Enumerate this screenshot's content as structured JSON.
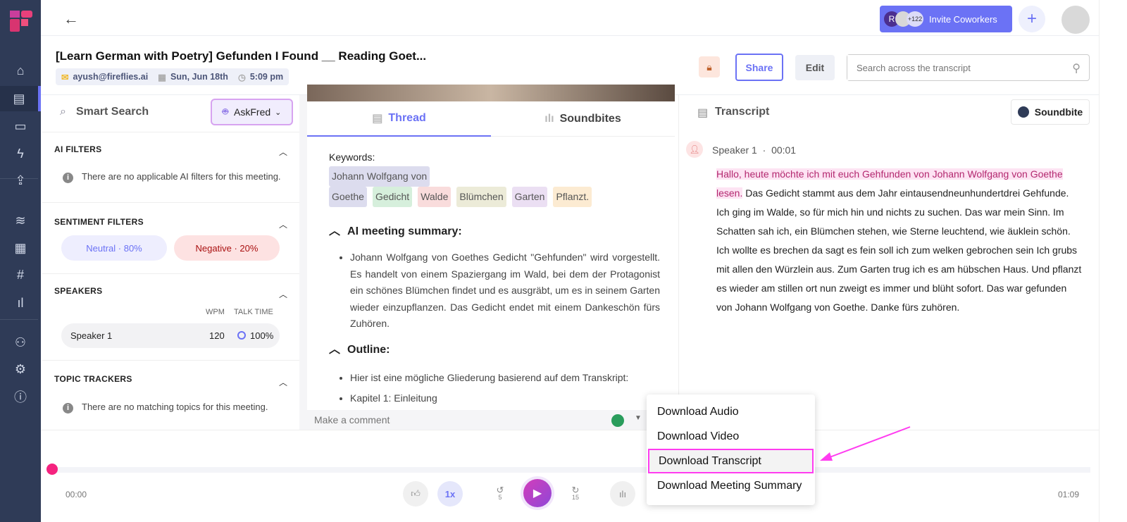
{
  "header": {
    "title": "[Learn German with Poetry] Gefunden I Found __ Reading Goet...",
    "email": "ayush@fireflies.ai",
    "date": "Sun, Jun 18th",
    "time": "5:09 pm",
    "invite": {
      "avatar_letter": "R",
      "count": "+122",
      "label": "Invite Coworkers"
    },
    "share": "Share",
    "edit": "Edit",
    "search_placeholder": "Search across the transcript"
  },
  "left": {
    "title": "Smart Search",
    "askfred": "AskFred",
    "ai_filters": {
      "title": "AI FILTERS",
      "empty": "There are no applicable AI filters for this meeting."
    },
    "sentiment": {
      "title": "SENTIMENT FILTERS",
      "neutral": "Neutral · 80%",
      "negative": "Negative · 20%"
    },
    "speakers": {
      "title": "SPEAKERS",
      "wpm_h": "WPM",
      "talk_h": "TALK TIME",
      "rows": [
        {
          "name": "Speaker 1",
          "wpm": "120",
          "talk": "100%"
        }
      ]
    },
    "topics": {
      "title": "TOPIC TRACKERS",
      "empty": "There are no matching topics for this meeting."
    }
  },
  "middle": {
    "tabs": [
      "Thread",
      "Soundbites"
    ],
    "keywords_label": "Keywords:",
    "keywords": [
      {
        "t": "Johann Wolfgang von",
        "c": "#dcdcee"
      },
      {
        "t": "Goethe",
        "c": "#dcdcee"
      },
      {
        "t": "Gedicht",
        "c": "#d6efdc"
      },
      {
        "t": "Walde",
        "c": "#f9dcdc"
      },
      {
        "t": "Blümchen",
        "c": "#ecebd8"
      },
      {
        "t": "Garten",
        "c": "#ebdff3"
      },
      {
        "t": "Pflanzt.",
        "c": "#fcebd2"
      }
    ],
    "summary_title": "AI meeting summary:",
    "summary": "Johann Wolfgang von Goethes Gedicht \"Gehfunden\" wird vorgestellt. Es handelt von einem Spaziergang im Wald, bei dem der Protagonist ein schönes Blümchen findet und es ausgräbt, um es in seinem Garten wieder einzupflanzen. Das Gedicht endet mit einem Dankeschön fürs Zuhören.",
    "outline_title": "Outline:",
    "outline": [
      "Hier ist eine mögliche Gliederung basierend auf dem Transkript:",
      "Kapitel 1: Einleitung"
    ],
    "comment_placeholder": "Make a comment"
  },
  "transcript": {
    "title": "Transcript",
    "soundbite": "Soundbite",
    "speaker": "Speaker 1",
    "time": "00:01",
    "highlight": "Hallo, heute möchte ich mit euch Gehfunden von Johann Wolfgang von Goethe lesen.",
    "text": " Das Gedicht stammt aus dem Jahr eintausendneunhundertdrei Gehfunde. Ich ging im Walde, so für mich hin und nichts zu suchen. Das war mein Sinn. Im Schatten sah ich, ein Blümchen stehen, wie Sterne leuchtend, wie äuklein schön. Ich wollte es brechen da sagt es fein soll ich zum welken gebrochen sein Ich grubs mit allen den Würzlein aus. Zum Garten trug ich es am hübschen Haus. Und pflanzt es wieder am stillen ort nun zweigt es immer und blüht sofort. Das war gefunden von Johann Wolfgang von Goethe. Danke fürs zuhören."
  },
  "menu": [
    "Download Audio",
    "Download Video",
    "Download Transcript",
    "Download Meeting Summary"
  ],
  "player": {
    "current": "00:00",
    "total": "01:09",
    "speed": "1x",
    "rewind": "5",
    "forward": "15",
    "progress": 0
  },
  "colors": {
    "accent": "#6b72f5",
    "highlight_border": "#ff3cf0",
    "play": "#c23fd1"
  }
}
